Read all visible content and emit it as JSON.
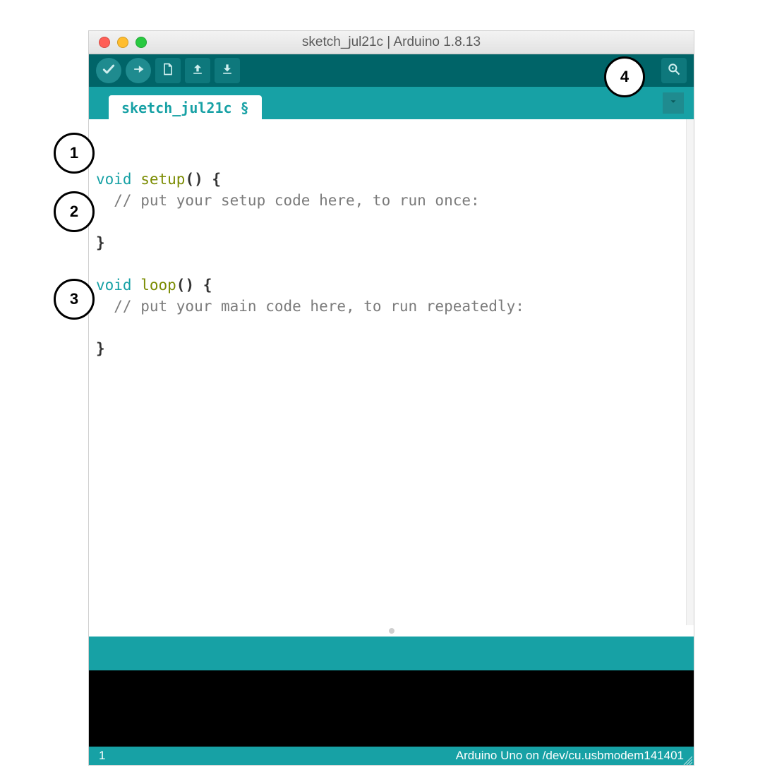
{
  "window": {
    "title": "sketch_jul21c | Arduino 1.8.13"
  },
  "toolbar": {
    "verify_tip": "Verify",
    "upload_tip": "Upload",
    "new_tip": "New",
    "open_tip": "Open",
    "save_tip": "Save",
    "serialmon_tip": "Serial Monitor"
  },
  "tabs": {
    "active_label": "sketch_jul21c §",
    "dropdown_tip": "Tab menu"
  },
  "code": {
    "line1_blank": "",
    "line2_void": "void",
    "line2_fn": " setup",
    "line2_rest": "() {",
    "line3_comment": "  // put your setup code here, to run once:",
    "line4_blank": "",
    "line5_close": "}",
    "line6_blank": "",
    "line7_void": "void",
    "line7_fn": " loop",
    "line7_rest": "() {",
    "line8_comment": "  // put your main code here, to run repeatedly:",
    "line9_blank": "",
    "line10_close": "}"
  },
  "footer": {
    "line_number": "1",
    "board_info": "Arduino Uno on /dev/cu.usbmodem141401"
  },
  "callouts": {
    "c1": "1",
    "c2": "2",
    "c3": "3",
    "c4": "4"
  }
}
